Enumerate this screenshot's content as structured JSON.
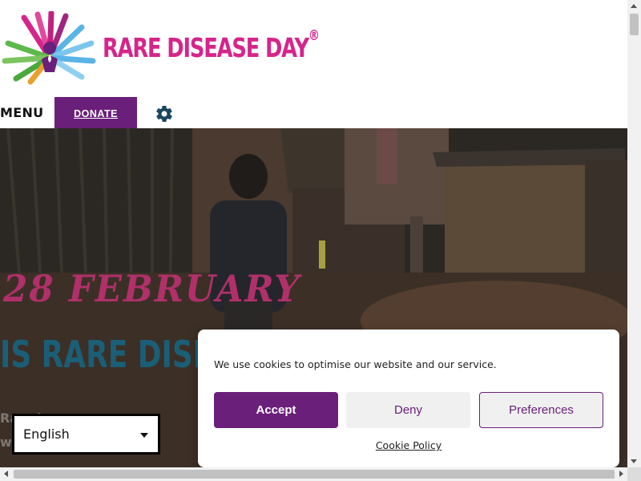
{
  "header": {
    "brand": "RARE DISEASE DAY",
    "brand_mark": "®",
    "menu_label": "MENU",
    "donate_label": "DONATE",
    "settings_icon": "gear-icon",
    "logo_icon": "hands-logo-icon"
  },
  "hero": {
    "date": "28 FEBRUARY",
    "headline": "IS RARE DISEA",
    "text_line1": "Ra              nd g",
    "text_line2": "w                h a r"
  },
  "language": {
    "selected": "English"
  },
  "cookie_banner": {
    "message": "We use cookies to optimise our website and our service.",
    "accept_label": "Accept",
    "deny_label": "Deny",
    "preferences_label": "Preferences",
    "policy_link": "Cookie Policy"
  },
  "colors": {
    "brand_pink": "#d6258a",
    "brand_purple": "#6a1f7a",
    "headline_teal": "#1a5f77",
    "settings_icon": "#1b4660"
  }
}
